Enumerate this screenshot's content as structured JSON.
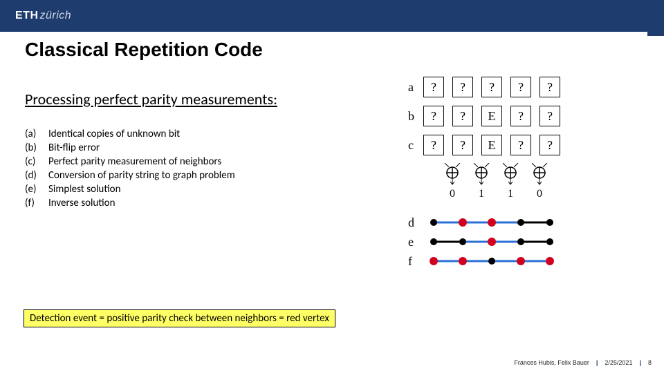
{
  "brand": {
    "name": "ETH",
    "suffix": "zürich"
  },
  "title": "Classical Repetition Code",
  "section_heading": "Processing perfect parity measurements:",
  "steps": [
    {
      "label": "(a)",
      "text": "Identical copies of unknown bit"
    },
    {
      "label": "(b)",
      "text": "Bit-flip error"
    },
    {
      "label": "(c)",
      "text": "Perfect parity measurement of neighbors"
    },
    {
      "label": "(d)",
      "text": "Conversion of parity string to graph problem"
    },
    {
      "label": "(e)",
      "text": "Simplest solution"
    },
    {
      "label": "(f)",
      "text": "Inverse solution"
    }
  ],
  "highlight": "Detection event = positive parity check between neighbors = red vertex",
  "footer": {
    "authors": "Frances Hubis, Felix Bauer",
    "date": "2/25/2021",
    "page": "8"
  },
  "diagram": {
    "rows": [
      {
        "label": "a",
        "cells": [
          "?",
          "?",
          "?",
          "?",
          "?"
        ]
      },
      {
        "label": "b",
        "cells": [
          "?",
          "?",
          "E",
          "?",
          "?"
        ]
      },
      {
        "label": "c",
        "cells": [
          "?",
          "?",
          "E",
          "?",
          "?"
        ]
      }
    ],
    "parity_results": [
      "0",
      "1",
      "1",
      "0"
    ],
    "graphs": [
      {
        "label": "d",
        "reds": [
          false,
          true,
          true,
          false,
          false
        ]
      },
      {
        "label": "e",
        "reds": [
          false,
          false,
          true,
          false,
          false
        ]
      },
      {
        "label": "f",
        "reds": [
          true,
          true,
          false,
          true,
          true
        ]
      }
    ]
  },
  "chart_data": {
    "type": "table",
    "title": "Classical repetition code — parity measurement diagram",
    "box_rows": {
      "a": [
        "?",
        "?",
        "?",
        "?",
        "?"
      ],
      "b": [
        "?",
        "?",
        "E",
        "?",
        "?"
      ],
      "c": [
        "?",
        "?",
        "E",
        "?",
        "?"
      ]
    },
    "parity_between_neighbors": [
      0,
      1,
      1,
      0
    ],
    "graph_vertices_red": {
      "d": [
        0,
        1,
        1,
        0,
        0
      ],
      "e": [
        0,
        0,
        1,
        0,
        0
      ],
      "f": [
        1,
        1,
        0,
        1,
        1
      ]
    }
  }
}
